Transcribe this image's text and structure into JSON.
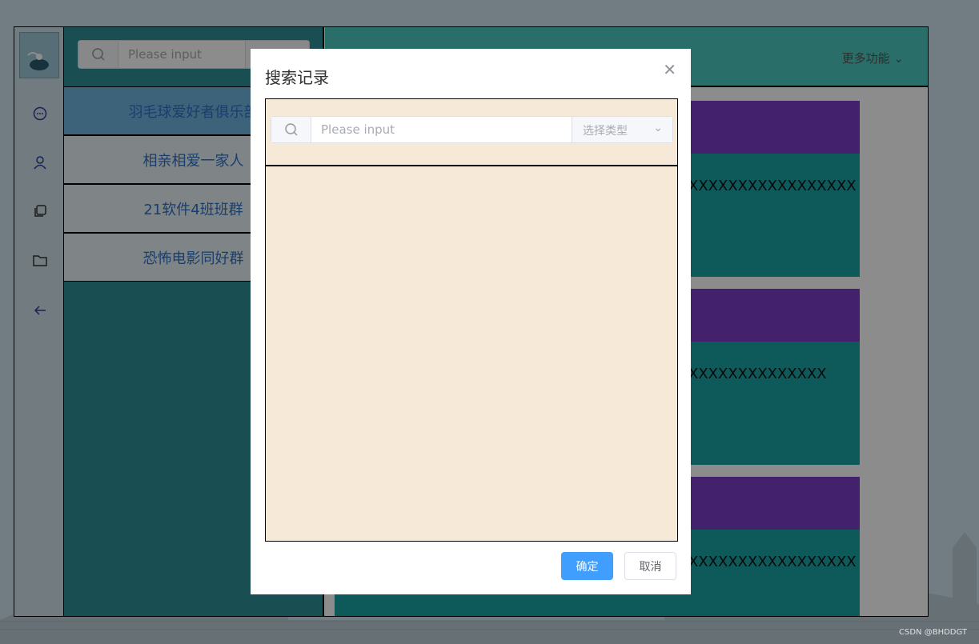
{
  "rail": {
    "icons": [
      "chat-bubble-icon",
      "user-icon",
      "copy-icon",
      "folder-icon",
      "arrow-left-icon"
    ]
  },
  "sidebar": {
    "search_placeholder": "Please input",
    "groups": [
      {
        "label": "羽毛球爱好者俱乐部"
      },
      {
        "label": "相亲相爱一家人"
      },
      {
        "label": "21软件4班班群"
      },
      {
        "label": "恐怖电影同好群"
      }
    ]
  },
  "chat": {
    "more_label": "更多功能",
    "messages": [
      {
        "text": "XXXXXXXXXXXXXXXXX"
      },
      {
        "text": "XXXXXXXXXXXXXX"
      },
      {
        "text": "XXXXXXXXXXXXXXXXX"
      }
    ]
  },
  "dialog": {
    "title": "搜索记录",
    "search_placeholder": "Please input",
    "type_select_placeholder": "选择类型",
    "ok_label": "确定",
    "cancel_label": "取消"
  },
  "watermark": "CSDN @BHDDGT",
  "colors": {
    "accent": "#409eff",
    "panel": "#f7e9d8",
    "msg_header": "#7a3cc7",
    "msg_body": "#1aa5a5",
    "chat_header": "#4ec9c2"
  }
}
